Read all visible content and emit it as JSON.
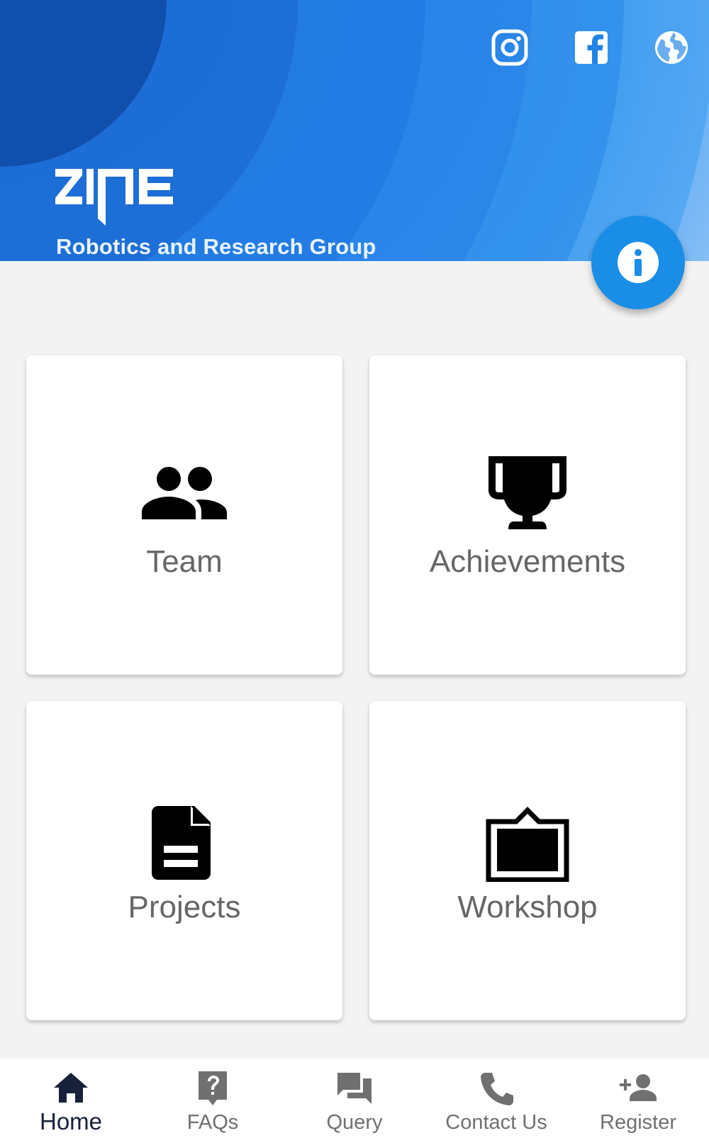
{
  "header": {
    "brand": "ZINE",
    "tagline": "Robotics and Research Group",
    "social": [
      {
        "icon": "instagram-icon"
      },
      {
        "icon": "facebook-icon"
      },
      {
        "icon": "globe-icon"
      }
    ],
    "colors": {
      "primary": "#1f7fe6",
      "dark": "#0f4fa8",
      "light": "#8fc4f7"
    }
  },
  "fab": {
    "icon": "info-icon",
    "color": "#1a8ee6"
  },
  "cards": [
    {
      "label": "Team",
      "icon": "team-icon"
    },
    {
      "label": "Achievements",
      "icon": "trophy-icon"
    },
    {
      "label": "Projects",
      "icon": "document-icon"
    },
    {
      "label": "Workshop",
      "icon": "workshop-icon"
    }
  ],
  "bottom_nav": [
    {
      "label": "Home",
      "icon": "home-icon",
      "active": true
    },
    {
      "label": "FAQs",
      "icon": "faq-icon"
    },
    {
      "label": "Query",
      "icon": "chat-icon"
    },
    {
      "label": "Contact Us",
      "icon": "phone-icon"
    },
    {
      "label": "Register",
      "icon": "add-person-icon"
    }
  ]
}
